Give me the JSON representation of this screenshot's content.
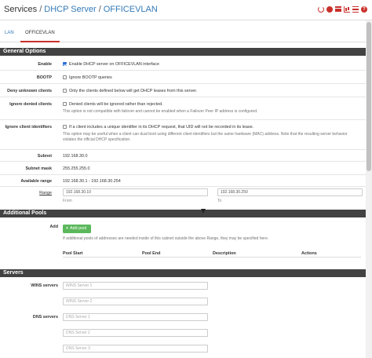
{
  "header": {
    "crumb_services": "Services",
    "crumb_dhcp": "DHCP Server",
    "crumb_vlan": "OFFICEVLAN",
    "sep1": "/",
    "sep2": "/",
    "icons": [
      "reload-icon",
      "stop-icon",
      "sliders-icon",
      "chart-icon",
      "list-icon",
      "help-icon"
    ],
    "help_glyph": "?"
  },
  "tabs": [
    {
      "label": "LAN",
      "active": false
    },
    {
      "label": "OFFICEVLAN",
      "active": true
    }
  ],
  "colors": {
    "accent": "#c9302c",
    "link": "#337ab7",
    "section": "#424242",
    "success": "#5cb85c"
  },
  "general": {
    "title": "General Options",
    "enable": {
      "label": "Enable",
      "text": "Enable DHCP server on OFFICEVLAN interface",
      "checked": true
    },
    "bootp": {
      "label": "BOOTP",
      "text": "Ignore BOOTP queries",
      "checked": false
    },
    "deny_unknown": {
      "label": "Deny unknown clients",
      "text": "Only the clients defined below will get DHCP leases from this server.",
      "checked": false
    },
    "ignore_denied": {
      "label": "Ignore denied clients",
      "text": "Denied clients will be ignored rather than rejected.",
      "hint": "This option is not compatible with failover and cannot be enabled when a Failover Peer IP address is configured.",
      "checked": false
    },
    "ignore_ids": {
      "label": "Ignore client identifiers",
      "text": "If a client includes a unique identifier in its DHCP request, that UID will not be recorded in its lease.",
      "hint": "This option may be useful when a client can dual boot using different client identifiers but the same hardware (MAC) address. Note that the resulting server behavior violates the official DHCP specification.",
      "checked": false
    },
    "subnet": {
      "label": "Subnet",
      "value": "192.168.30.0"
    },
    "mask": {
      "label": "Subnet mask",
      "value": "255.255.255.0"
    },
    "available": {
      "label": "Available range",
      "value": "192.168.30.1 - 192.168.30.254"
    },
    "range": {
      "label": "Range",
      "from": "192.168.30.10",
      "from_label": "From",
      "to": "192.168.30.250",
      "to_label": "To"
    }
  },
  "pools": {
    "title": "Additional Pools",
    "add_label": "Add",
    "add_button": "Add pool",
    "add_plus": "+",
    "hint": "If additional pools of addresses are needed inside of this subnet outside the above Range, they may be specified here.",
    "columns": [
      "Pool Start",
      "Pool End",
      "Description",
      "Actions"
    ]
  },
  "servers": {
    "title": "Servers",
    "wins_label": "WINS servers",
    "wins": [
      "WINS Server 1",
      "WINS Server 2"
    ],
    "dns_label": "DNS servers",
    "dns": [
      "DNS Server 1",
      "DNS Server 2",
      "DNS Server 3"
    ]
  }
}
